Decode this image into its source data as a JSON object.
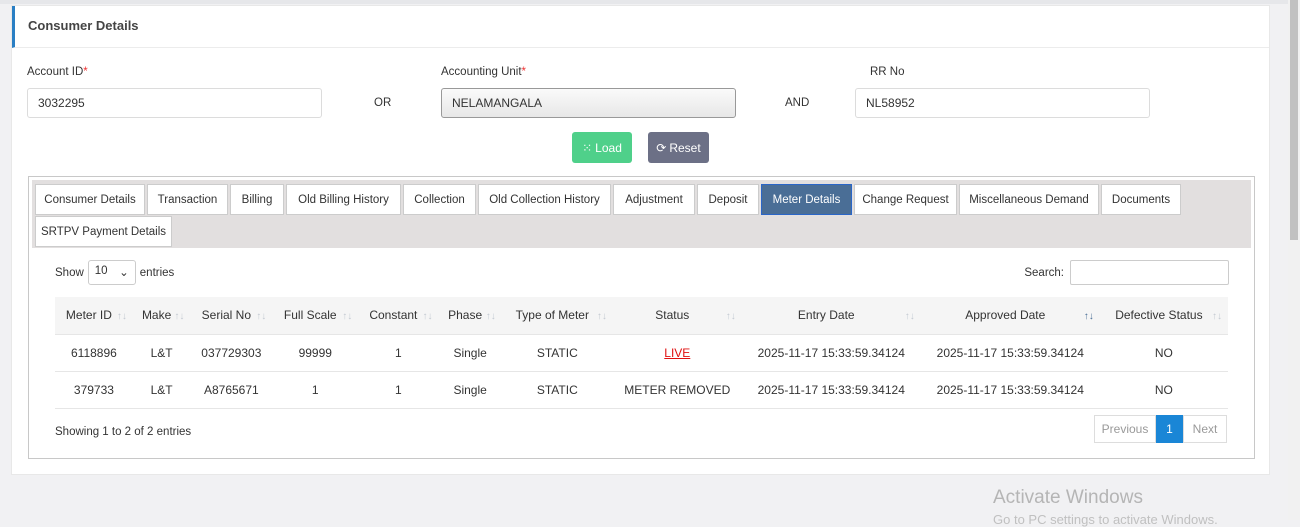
{
  "card": {
    "title": "Consumer Details"
  },
  "form": {
    "account_id": {
      "label": "Account ID",
      "value": "3032295"
    },
    "or": "OR",
    "accounting_unit": {
      "label": "Accounting Unit",
      "value": "NELAMANGALA"
    },
    "and": "AND",
    "rr_no": {
      "label": "RR No",
      "value": "NL58952"
    },
    "required_mark": "*",
    "load": "Load",
    "reset": "Reset"
  },
  "tabs": [
    "Consumer Details",
    "Transaction",
    "Billing",
    "Old Billing History",
    "Collection",
    "Old Collection History",
    "Adjustment",
    "Deposit",
    "Meter Details",
    "Change Request",
    "Miscellaneous Demand",
    "Documents",
    "SRTPV Payment Details"
  ],
  "table": {
    "show": "Show",
    "length": "10",
    "entries": "entries",
    "search": "Search:",
    "columns": [
      "Meter ID",
      "Make",
      "Serial No",
      "Full Scale",
      "Constant",
      "Phase",
      "Type of Meter",
      "Status",
      "Entry Date",
      "Approved Date",
      "Defective Status"
    ],
    "rows": [
      [
        "6118896",
        "L&T",
        "037729303",
        "99999",
        "1",
        "Single",
        "STATIC",
        "LIVE",
        "2025-11-17 15:33:59.34124",
        "2025-11-17 15:33:59.34124",
        "NO"
      ],
      [
        "379733",
        "L&T",
        "A8765671",
        "1",
        "1",
        "Single",
        "STATIC",
        "METER REMOVED",
        "2025-11-17 15:33:59.34124",
        "2025-11-17 15:33:59.34124",
        "NO"
      ]
    ],
    "info": "Showing 1 to 2 of 2 entries",
    "previous": "Previous",
    "page": "1",
    "next": "Next"
  },
  "watermark": {
    "line1": "Activate Windows",
    "line2": "Go to PC settings to activate Windows."
  }
}
